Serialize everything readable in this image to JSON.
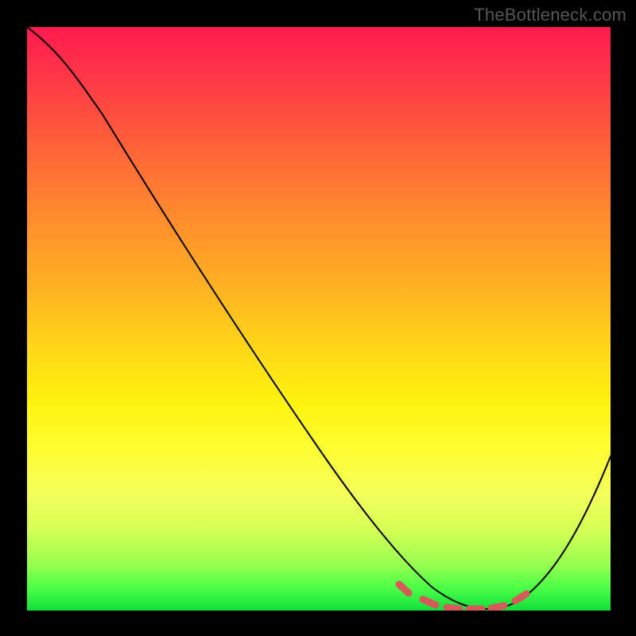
{
  "watermark": "TheBottleneck.com",
  "colors": {
    "frame_bg": "#000000",
    "gradient_top": "#ff1a4e",
    "gradient_mid": "#fff20e",
    "gradient_bottom": "#10e03b",
    "curve": "#000000",
    "markers": "#d65a5a"
  },
  "chart_data": {
    "type": "line",
    "title": "",
    "xlabel": "",
    "ylabel": "",
    "xlim": [
      0,
      100
    ],
    "ylim": [
      0,
      100
    ],
    "x": [
      0,
      5,
      10,
      15,
      20,
      25,
      30,
      35,
      40,
      45,
      50,
      55,
      60,
      63,
      66,
      69,
      72,
      75,
      78,
      81,
      84,
      87,
      90,
      93,
      96,
      100
    ],
    "values": [
      100,
      98,
      93,
      86,
      79,
      72,
      65,
      58,
      51,
      44,
      37,
      29,
      21,
      15,
      10,
      6,
      3,
      1,
      0,
      0,
      1,
      3,
      7,
      12,
      18,
      27
    ],
    "markers_x": [
      63,
      67,
      70,
      73,
      76,
      79,
      82,
      85
    ],
    "markers_y": [
      5,
      2.5,
      1.2,
      0.5,
      0.2,
      0.3,
      0.9,
      2.2
    ],
    "annotations": [],
    "legend": []
  }
}
